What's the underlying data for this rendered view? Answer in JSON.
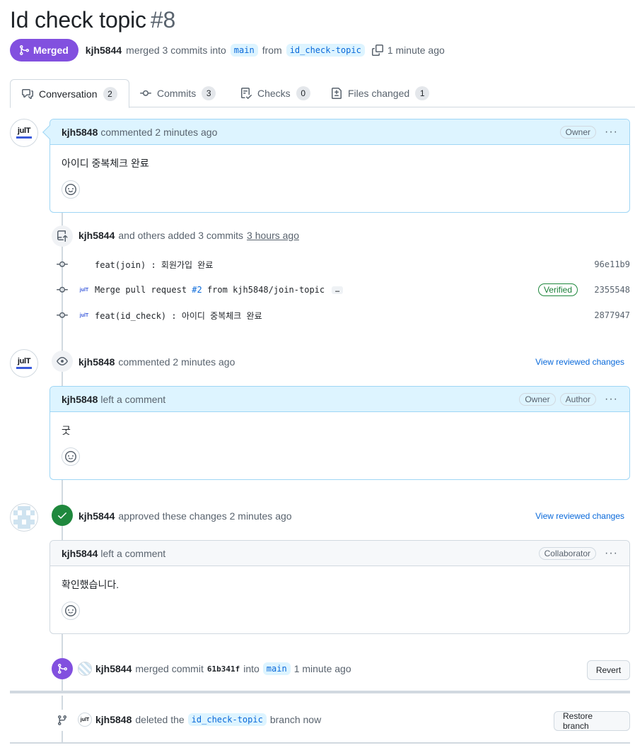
{
  "pr": {
    "title": "Id check topic",
    "number": "#8",
    "status": "Merged",
    "author": "kjh5844",
    "merge_text": "merged 3 commits into",
    "base_branch": "main",
    "from_text": "from",
    "head_branch": "id_check-topic",
    "time": "1 minute ago"
  },
  "tabs": [
    {
      "label": "Conversation",
      "count": "2"
    },
    {
      "label": "Commits",
      "count": "3"
    },
    {
      "label": "Checks",
      "count": "0"
    },
    {
      "label": "Files changed",
      "count": "1"
    }
  ],
  "comment1": {
    "author": "kjh5848",
    "action": "commented 2 minutes ago",
    "badge": "Owner",
    "body": "아이디 중복체크 완료"
  },
  "commits_event": {
    "author": "kjh5844",
    "text": "and others added 3 commits",
    "time": "3 hours ago",
    "items": [
      {
        "message": "feat(join) : 회원가입 완료",
        "sha": "96e11b9"
      },
      {
        "message_pre": "Merge pull request ",
        "message_link": "#2",
        "message_post": " from kjh5848/join-topic",
        "ellipsis": "…",
        "verified": "Verified",
        "sha": "2355548"
      },
      {
        "message": "feat(id_check) : 아이디 중복체크 완료",
        "sha": "2877947"
      }
    ]
  },
  "review1": {
    "author": "kjh5848",
    "action": "commented 2 minutes ago",
    "link": "View reviewed changes",
    "comment_author": "kjh5848",
    "comment_action": "left a comment",
    "badges": [
      "Owner",
      "Author"
    ],
    "body": "굿"
  },
  "review2": {
    "author": "kjh5844",
    "action": "approved these changes 2 minutes ago",
    "link": "View reviewed changes",
    "comment_author": "kjh5844",
    "comment_action": "left a comment",
    "badge": "Collaborator",
    "body": "확인했습니다."
  },
  "merge_event": {
    "author": "kjh5844",
    "text": "merged commit",
    "sha": "61b341f",
    "into": "into",
    "branch": "main",
    "time": "1 minute ago",
    "button": "Revert"
  },
  "delete_event": {
    "author": "kjh5848",
    "text": "deleted the",
    "branch": "id_check-topic",
    "suffix": "branch now",
    "button": "Restore branch"
  },
  "logo": {
    "text": "julT"
  },
  "colors": {
    "merged": "#8250df",
    "approved": "#1f883d",
    "link": "#0969da",
    "comment_header": "#ddf4ff"
  }
}
